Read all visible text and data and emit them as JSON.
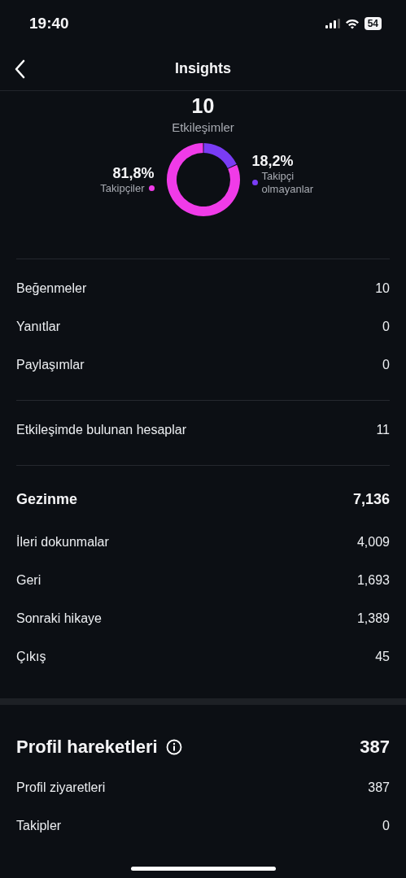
{
  "status_bar": {
    "time": "19:40",
    "battery": "54"
  },
  "nav": {
    "title": "Insights"
  },
  "interactions": {
    "total": "10",
    "legend": [
      {
        "value": "81,8%",
        "color": "#f03be8"
      },
      {
        "value": "18,2%",
        "color": "#7a3cf5"
      }
    ],
    "chart_data": {
      "type": "donut",
      "categories": [
        "Takipçiler",
        "Takipçi olmayanlar"
      ],
      "series": [
        {
          "name": "Etkileşimler",
          "values": [
            81.8,
            18.2
          ]
        }
      ]
    }
  },
  "groups": [
    {
      "kind": "line",
      "rows": [
        {
          "label": "Beğenmeler",
          "value": "10"
        },
        {
          "label": "Yanıtlar",
          "value": "0"
        },
        {
          "label": "Paylaşımlar",
          "value": "0"
        }
      ]
    },
    {
      "kind": "line",
      "rows": [
        {
          "label": "Etkileşimde bulunan hesaplar",
          "value": "11"
        }
      ]
    },
    {
      "kind": "line",
      "header": {
        "kind": "section",
        "label": "Gezinme",
        "value": "7,136"
      },
      "rows": [
        {
          "label": "İleri dokunmalar",
          "value": "4,009"
        },
        {
          "label": "Geri",
          "value": "1,693"
        },
        {
          "label": "Sonraki hikaye",
          "value": "1,389"
        },
        {
          "label": "Çıkış",
          "value": "45"
        }
      ]
    },
    {
      "kind": "band",
      "header": {
        "kind": "major",
        "label": "Profil hareketleri",
        "value": "387"
      },
      "rows": [
        {
          "label": "Profil ziyaretleri",
          "value": "387"
        },
        {
          "label": "Takipler",
          "value": "0"
        }
      ]
    }
  ]
}
